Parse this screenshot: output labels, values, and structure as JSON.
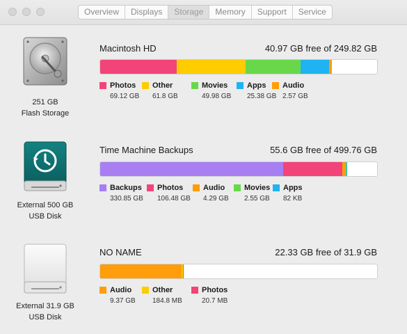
{
  "toolbar": {
    "tabs": [
      "Overview",
      "Displays",
      "Storage",
      "Memory",
      "Support",
      "Service"
    ],
    "active_tab": "Storage"
  },
  "drives": [
    {
      "icon": "hard-drive-icon",
      "caption_line1": "251 GB",
      "caption_line2": "Flash Storage",
      "name": "Macintosh HD",
      "free_text": "40.97 GB free of 249.82 GB",
      "usage": [
        {
          "label": "Photos",
          "size": "69.12 GB",
          "gb": 69.12,
          "color": "#f24479"
        },
        {
          "label": "Other",
          "size": "61.8 GB",
          "gb": 61.8,
          "color": "#ffcc00"
        },
        {
          "label": "Movies",
          "size": "49.98 GB",
          "gb": 49.98,
          "color": "#68d84a"
        },
        {
          "label": "Apps",
          "size": "25.38 GB",
          "gb": 25.38,
          "color": "#1fb3f2"
        },
        {
          "label": "Audio",
          "size": "2.57 GB",
          "gb": 2.57,
          "color": "#ff9d0a"
        }
      ],
      "total_gb": 249.82
    },
    {
      "icon": "time-machine-icon",
      "caption_line1": "External 500 GB",
      "caption_line2": "USB Disk",
      "name": "Time Machine Backups",
      "free_text": "55.6 GB free of 499.76 GB",
      "usage": [
        {
          "label": "Backups",
          "size": "330.85 GB",
          "gb": 330.85,
          "color": "#a77ff2"
        },
        {
          "label": "Photos",
          "size": "106.48 GB",
          "gb": 106.48,
          "color": "#f24479"
        },
        {
          "label": "Audio",
          "size": "4.29 GB",
          "gb": 4.29,
          "color": "#ff9d0a"
        },
        {
          "label": "Movies",
          "size": "2.55 GB",
          "gb": 2.55,
          "color": "#68d84a"
        },
        {
          "label": "Apps",
          "size": "82 KB",
          "gb": 0.0001,
          "color": "#1fb3f2"
        }
      ],
      "total_gb": 499.76
    },
    {
      "icon": "external-drive-icon",
      "caption_line1": "External 31.9 GB",
      "caption_line2": "USB Disk",
      "name": "NO NAME",
      "free_text": "22.33 GB free of 31.9 GB",
      "usage": [
        {
          "label": "Audio",
          "size": "9.37 GB",
          "gb": 9.37,
          "color": "#ff9d0a"
        },
        {
          "label": "Other",
          "size": "184.8 MB",
          "gb": 0.1848,
          "color": "#ffcc00"
        },
        {
          "label": "Photos",
          "size": "20.7 MB",
          "gb": 0.0207,
          "color": "#f24479"
        }
      ],
      "total_gb": 31.9
    }
  ]
}
